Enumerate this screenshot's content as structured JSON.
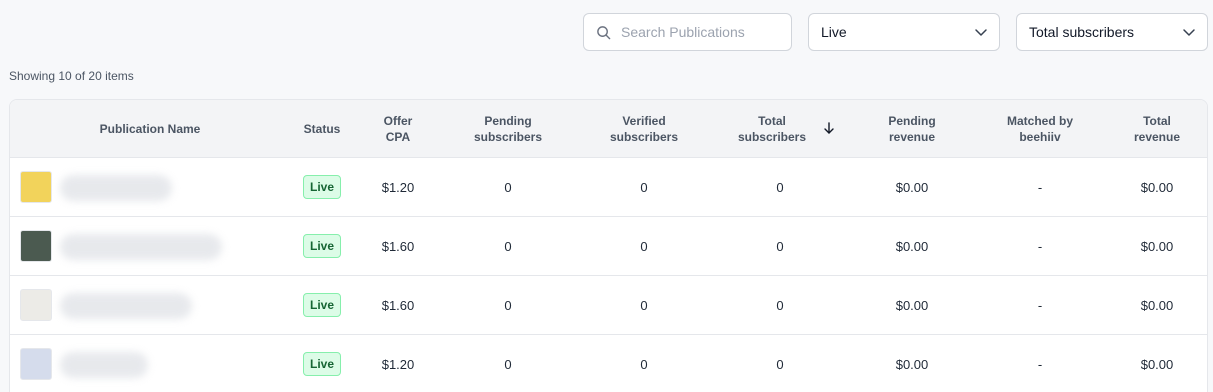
{
  "search": {
    "placeholder": "Search Publications",
    "value": ""
  },
  "filters": {
    "status": {
      "selected": "Live"
    },
    "sort": {
      "selected": "Total subscribers"
    }
  },
  "summary": "Showing 10 of 20 items",
  "table": {
    "columns": [
      {
        "key": "name",
        "label": "Publication Name"
      },
      {
        "key": "status",
        "label": "Status"
      },
      {
        "key": "offer_cpa",
        "label": "Offer CPA"
      },
      {
        "key": "pending_subscribers",
        "label": "Pending subscribers"
      },
      {
        "key": "verified_subscribers",
        "label": "Verified subscribers"
      },
      {
        "key": "total_subscribers",
        "label": "Total subscribers",
        "sorted": "descending"
      },
      {
        "key": "pending_revenue",
        "label": "Pending revenue"
      },
      {
        "key": "matched_by",
        "label": "Matched by beehiiv"
      },
      {
        "key": "total_revenue",
        "label": "Total revenue"
      }
    ],
    "rows": [
      {
        "thumb_color": "#f2d35b",
        "status": "Live",
        "offer_cpa": "$1.20",
        "pending_subscribers": "0",
        "verified_subscribers": "0",
        "total_subscribers": "0",
        "pending_revenue": "$0.00",
        "matched_by": "-",
        "total_revenue": "$0.00"
      },
      {
        "thumb_color": "#4b5a50",
        "status": "Live",
        "offer_cpa": "$1.60",
        "pending_subscribers": "0",
        "verified_subscribers": "0",
        "total_subscribers": "0",
        "pending_revenue": "$0.00",
        "matched_by": "-",
        "total_revenue": "$0.00"
      },
      {
        "thumb_color": "#ecebe7",
        "status": "Live",
        "offer_cpa": "$1.60",
        "pending_subscribers": "0",
        "verified_subscribers": "0",
        "total_subscribers": "0",
        "pending_revenue": "$0.00",
        "matched_by": "-",
        "total_revenue": "$0.00"
      },
      {
        "thumb_color": "#d5dcec",
        "status": "Live",
        "offer_cpa": "$1.20",
        "pending_subscribers": "0",
        "verified_subscribers": "0",
        "total_subscribers": "0",
        "pending_revenue": "$0.00",
        "matched_by": "-",
        "total_revenue": "$0.00"
      }
    ]
  },
  "icons": {
    "search": "search-icon",
    "chevron": "chevron-down-icon",
    "sort": "arrow-down-icon"
  },
  "colors": {
    "live_badge_bg": "#dcfce7",
    "live_badge_border": "#86efac",
    "live_badge_text": "#166534"
  }
}
